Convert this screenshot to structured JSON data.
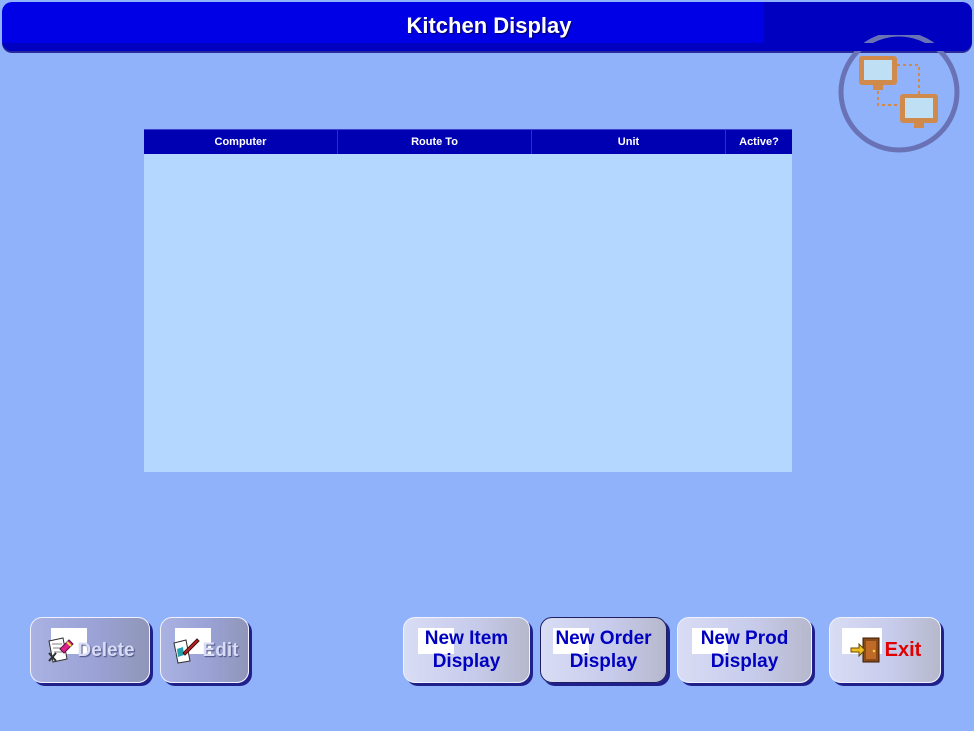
{
  "window": {
    "title": "Kitchen Display"
  },
  "grid": {
    "columns": [
      "Computer",
      "Route To",
      "Unit",
      "Active?"
    ],
    "rows": []
  },
  "buttons": {
    "delete": "Delete",
    "edit": "Edit",
    "new_item_line1": "New Item",
    "new_item_line2": "Display",
    "new_order_line1": "New Order",
    "new_order_line2": "Display",
    "new_prod_line1": "New Prod",
    "new_prod_line2": "Display",
    "exit": "Exit"
  },
  "icons": {
    "header": "network-computers-icon",
    "delete": "delete-document-icon",
    "edit": "edit-document-icon",
    "exit": "exit-door-icon"
  },
  "colors": {
    "background": "#8fb2fb",
    "title_bar": "#0000e6",
    "grid_header": "#0000b3",
    "grid_body": "#b3d7ff",
    "button_text": "#0000c0",
    "exit_text": "#e00000"
  }
}
